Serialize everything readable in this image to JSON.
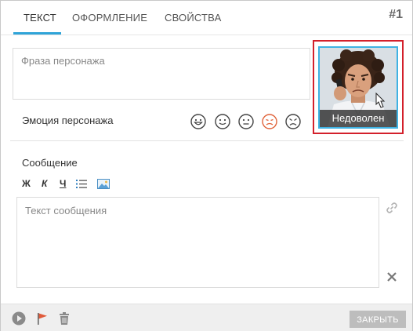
{
  "tabs": [
    {
      "label": "ТЕКСТ",
      "active": true
    },
    {
      "label": "ОФОРМЛЕНИЕ",
      "active": false
    },
    {
      "label": "СВОЙСТВА",
      "active": false
    }
  ],
  "slide_number": "#1",
  "phrase": {
    "placeholder": "Фраза персонажа"
  },
  "character": {
    "caption": "Недоволен"
  },
  "emotion": {
    "label": "Эмоция персонажа",
    "icons": [
      "happy-face-icon",
      "smile-face-icon",
      "neutral-face-icon",
      "sad-face-icon",
      "angry-face-icon"
    ],
    "selected_index": 3
  },
  "message": {
    "label": "Сообщение",
    "placeholder": "Текст сообщения",
    "format_buttons": {
      "bold": "Ж",
      "italic": "К",
      "underline": "Ч"
    }
  },
  "footer": {
    "close_label": "ЗАКРЫТЬ"
  },
  "colors": {
    "accent": "#2fa4d8",
    "highlight_border": "#d3202b",
    "selected_emotion": "#e0633a",
    "flag": "#e05a3a"
  }
}
